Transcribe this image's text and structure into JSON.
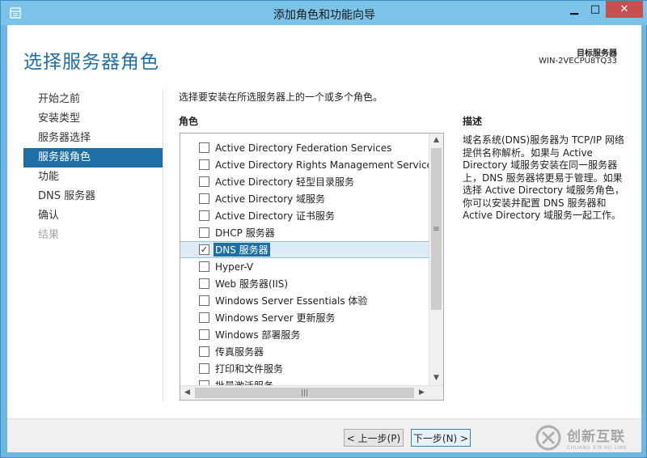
{
  "window": {
    "title": "添加角色和功能向导",
    "min_glyph": "▁",
    "max_glyph": "□",
    "close_glyph": "✕"
  },
  "header": {
    "page_title": "选择服务器角色",
    "target_label": "目标服务器",
    "target_name": "WIN-2VECPU8TQ33"
  },
  "nav": {
    "items": [
      {
        "label": "开始之前",
        "state": "normal"
      },
      {
        "label": "安装类型",
        "state": "normal"
      },
      {
        "label": "服务器选择",
        "state": "normal"
      },
      {
        "label": "服务器角色",
        "state": "active"
      },
      {
        "label": "功能",
        "state": "normal"
      },
      {
        "label": "DNS 服务器",
        "state": "normal"
      },
      {
        "label": "确认",
        "state": "normal"
      },
      {
        "label": "结果",
        "state": "disabled"
      }
    ]
  },
  "main": {
    "instruction": "选择要安装在所选服务器上的一个或多个角色。",
    "roles_heading": "角色",
    "roles": [
      {
        "label": "Active Directory Federation Services",
        "checked": false
      },
      {
        "label": "Active Directory Rights Management Services",
        "checked": false
      },
      {
        "label": "Active Directory 轻型目录服务",
        "checked": false
      },
      {
        "label": "Active Directory 域服务",
        "checked": false
      },
      {
        "label": "Active Directory 证书服务",
        "checked": false
      },
      {
        "label": "DHCP 服务器",
        "checked": false
      },
      {
        "label": "DNS 服务器",
        "checked": true,
        "selected": true
      },
      {
        "label": "Hyper-V",
        "checked": false
      },
      {
        "label": "Web 服务器(IIS)",
        "checked": false
      },
      {
        "label": "Windows Server Essentials 体验",
        "checked": false
      },
      {
        "label": "Windows Server 更新服务",
        "checked": false
      },
      {
        "label": "Windows 部署服务",
        "checked": false
      },
      {
        "label": "传真服务器",
        "checked": false
      },
      {
        "label": "打印和文件服务",
        "checked": false
      },
      {
        "label": "批量激活服务",
        "checked": false
      }
    ],
    "description_heading": "描述",
    "description": "域名系统(DNS)服务器为 TCP/IP 网络提供名称解析。如果与 Active Directory 域服务安装在同一服务器上，DNS 服务器将更易于管理。如果选择 Active Directory 域服务角色，你可以安装并配置 DNS 服务器和 Active Directory 域服务一起工作。"
  },
  "footer": {
    "prev_label": "< 上一步(P)",
    "next_label": "下一步(N) >"
  },
  "watermark": {
    "cn": "创新互联",
    "en": "CHUANG XIN HU LIAN"
  }
}
